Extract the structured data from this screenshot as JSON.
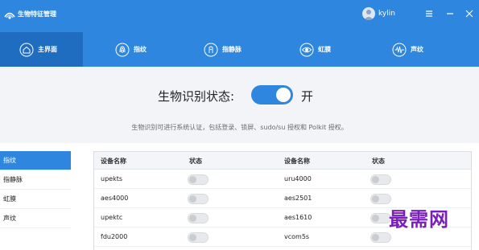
{
  "app": {
    "title": "生物特征管理"
  },
  "user": {
    "name": "kylin"
  },
  "tabs": [
    {
      "label": "主界面",
      "icon": "home-icon",
      "active": true
    },
    {
      "label": "指纹",
      "icon": "fingerprint-icon",
      "active": false
    },
    {
      "label": "指静脉",
      "icon": "finger-vein-icon",
      "active": false
    },
    {
      "label": "虹膜",
      "icon": "iris-eye-icon",
      "active": false
    },
    {
      "label": "声纹",
      "icon": "voiceprint-icon",
      "active": false
    }
  ],
  "status": {
    "label": "生物识别状态:",
    "value": "开",
    "enabled": true,
    "description": "生物识别可进行系统认证，包括登录、锁屏、sudo/su 授权和 Polkit 授权。"
  },
  "sidebar": {
    "items": [
      {
        "label": "指纹",
        "active": true
      },
      {
        "label": "指静脉",
        "active": false
      },
      {
        "label": "虹膜",
        "active": false
      },
      {
        "label": "声纹",
        "active": false
      }
    ]
  },
  "table": {
    "headers": {
      "device_name": "设备名称",
      "status": "状态"
    },
    "rows": [
      {
        "left": "upekts",
        "right": "uru4000"
      },
      {
        "left": "aes4000",
        "right": "aes2501"
      },
      {
        "left": "upektc",
        "right": "aes1610"
      },
      {
        "left": "fdu2000",
        "right": "vcom5s"
      }
    ]
  },
  "watermark": "最需网",
  "colors": {
    "accent": "#2e86de",
    "accent_dark": "#1f6dc1",
    "watermark": "#7a1fb8"
  }
}
